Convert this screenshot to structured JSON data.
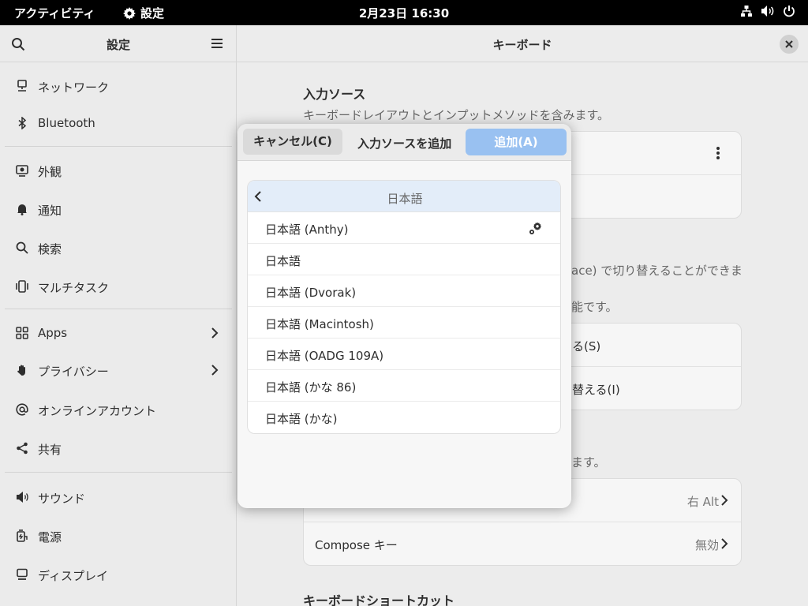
{
  "topbar": {
    "activities": "アクティビティ",
    "app_name": "設定",
    "clock": "2月23日  16:30",
    "status_icons": [
      "network-icon",
      "volume-icon",
      "power-icon"
    ]
  },
  "sidebar": {
    "title": "設定",
    "items": [
      {
        "label": "ネットワーク",
        "icon": "network-icon"
      },
      {
        "label": "Bluetooth",
        "icon": "bluetooth-icon"
      },
      {
        "label": "外観",
        "icon": "appearance-icon"
      },
      {
        "label": "通知",
        "icon": "bell-icon"
      },
      {
        "label": "検索",
        "icon": "search-icon"
      },
      {
        "label": "マルチタスク",
        "icon": "multitask-icon"
      },
      {
        "label": "Apps",
        "icon": "apps-icon"
      },
      {
        "label": "プライバシー",
        "icon": "hand-icon"
      },
      {
        "label": "オンラインアカウント",
        "icon": "at-icon"
      },
      {
        "label": "共有",
        "icon": "share-icon"
      },
      {
        "label": "サウンド",
        "icon": "sound-icon"
      },
      {
        "label": "電源",
        "icon": "power-plug-icon"
      },
      {
        "label": "ディスプレイ",
        "icon": "display-icon"
      }
    ]
  },
  "main": {
    "title": "キーボード",
    "input_sources": {
      "title": "入力ソース",
      "description": "キーボードレイアウトとインプットメソッドを含みます。"
    },
    "partial_texts": {
      "switch_desc": "ace) で切り替えることができま",
      "switch_desc2": "能です。",
      "row1": "る(S)",
      "row2": "替える(I)",
      "special_desc": "ます。"
    },
    "special_keys": {
      "alt_value": "右 Alt",
      "compose_label": "Compose キー",
      "compose_value": "無効"
    },
    "shortcuts_title": "キーボードショートカット"
  },
  "dialog": {
    "cancel": "キャンセル(C)",
    "title": "入力ソースを追加",
    "add": "追加(A)",
    "list_header": "日本語",
    "items": [
      "日本語 (Anthy)",
      "日本語",
      "日本語 (Dvorak)",
      "日本語 (Macintosh)",
      "日本語 (OADG 109A)",
      "日本語 (かな 86)",
      "日本語 (かな)"
    ]
  },
  "colors": {
    "accent_disabled": "#99c1f1",
    "list_header_bg": "#e3edf9"
  }
}
